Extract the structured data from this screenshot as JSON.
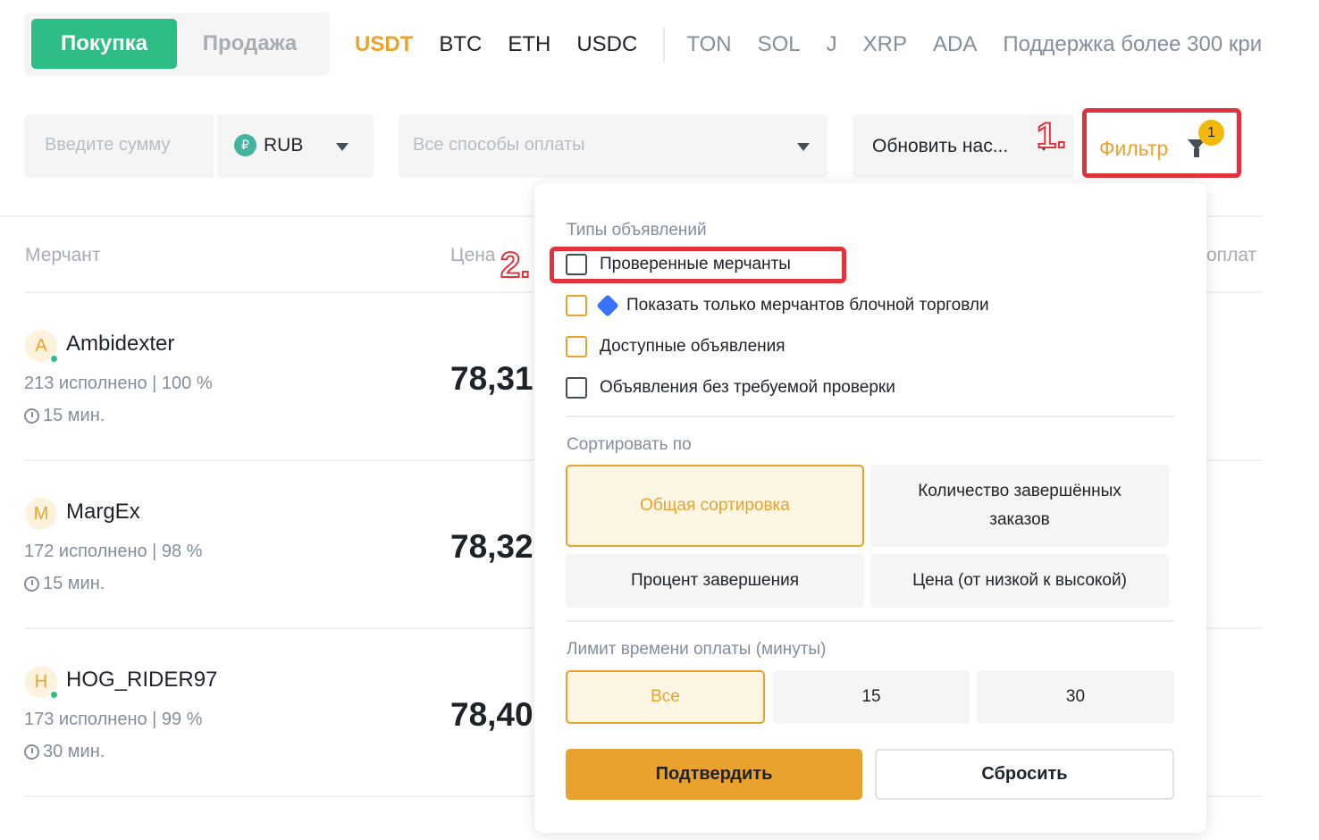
{
  "mode": {
    "buy": "Покупка",
    "sell": "Продажа"
  },
  "coins": {
    "primary": [
      "USDT",
      "BTC",
      "ETH",
      "USDC"
    ],
    "secondary": [
      "TON",
      "SOL",
      "J",
      "XRP",
      "ADA"
    ],
    "more": "Поддержка более 300 кри"
  },
  "filters": {
    "amount_placeholder": "Введите сумму",
    "currency": "RUB",
    "currency_icon": "₽",
    "payment_placeholder": "Все способы оплаты",
    "refresh": "Обновить нас...",
    "filter_label": "Фильтр",
    "filter_count": "1"
  },
  "annotations": {
    "step1": "1.",
    "step2": "2."
  },
  "table": {
    "headers": {
      "merchant": "Мерчант",
      "price": "Цена",
      "payment": "оплат"
    },
    "rows": [
      {
        "initial": "A",
        "name": "Ambidexter",
        "stats": "213 исполнено  |  100 %",
        "time": "15 мин.",
        "price": "78,31"
      },
      {
        "initial": "M",
        "name": "MargEx",
        "stats": "172 исполнено  |  98 %",
        "time": "15 мин.",
        "price": "78,32"
      },
      {
        "initial": "H",
        "name": "HOG_RIDER97",
        "stats": "173 исполнено  |  99 %",
        "time": "30 мин.",
        "price": "78,40"
      }
    ]
  },
  "panel": {
    "ad_types_title": "Типы объявлений",
    "checkboxes": [
      "Проверенные мерчанты",
      "Показать только мерчантов блочной торговли",
      "Доступные объявления",
      "Объявления без требуемой проверки"
    ],
    "sort_title": "Сортировать по",
    "sort_options": [
      "Общая сортировка",
      "Количество завершённых заказов",
      "Процент завершения",
      "Цена (от низкой к высокой)"
    ],
    "time_title": "Лимит времени оплаты (минуты)",
    "time_options": [
      "Все",
      "15",
      "30"
    ],
    "confirm": "Подтвердить",
    "reset": "Сбросить"
  },
  "colors": {
    "accent": "#e9a22d",
    "buy": "#2ebd85",
    "highlight": "#e0333c"
  }
}
